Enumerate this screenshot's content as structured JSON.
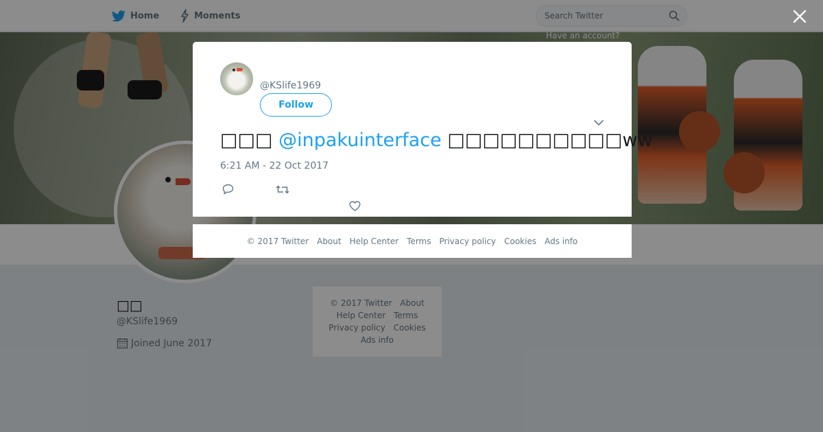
{
  "nav": {
    "home_label": "Home",
    "moments_label": "Moments",
    "search_placeholder": "Search Twitter",
    "have_account_text": "Have an account?"
  },
  "profile": {
    "name": "□□",
    "handle": "@KSlife1969",
    "joined": "Joined June 2017"
  },
  "side_footer": {
    "links": [
      "© 2017 Twitter",
      "About",
      "Help Center",
      "Terms",
      "Privacy policy",
      "Cookies",
      "Ads info"
    ]
  },
  "tweet": {
    "handle": "@KSlife1969",
    "follow_label": "Follow",
    "text_before": "□□□ ",
    "mention": "@inpakuinterface",
    "text_after": " □□□□□□□□□□ww",
    "timestamp": "6:21 AM - 22 Oct 2017"
  },
  "modal_footer": {
    "links": [
      "© 2017 Twitter",
      "About",
      "Help Center",
      "Terms",
      "Privacy policy",
      "Cookies",
      "Ads info"
    ]
  },
  "icons": {
    "brand": "twitter-bird-icon",
    "moments": "lightning-icon",
    "search": "search-icon",
    "close": "close-icon",
    "caret": "chevron-down-icon",
    "reply": "reply-icon",
    "retweet": "retweet-icon",
    "like": "heart-icon",
    "calendar": "calendar-icon"
  },
  "colors": {
    "brand_blue": "#1da1f2",
    "text_dark": "#14171a",
    "text_muted": "#657786",
    "page_bg": "#e6ecf0",
    "overlay": "rgba(0,0,0,0.45)"
  }
}
